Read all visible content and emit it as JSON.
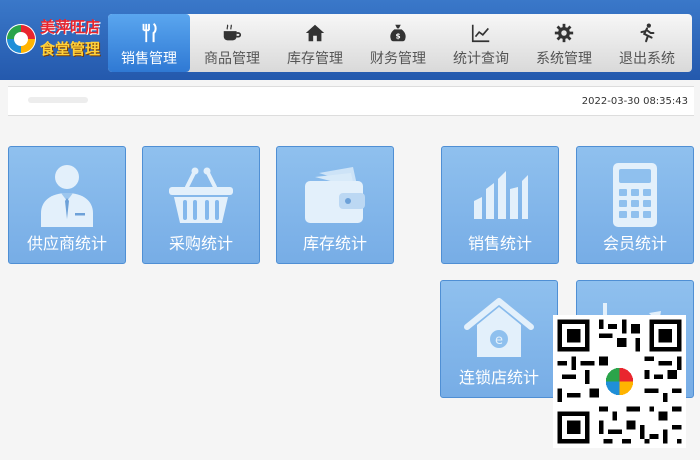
{
  "brand": {
    "line1": "美萍旺店",
    "line2": "食堂管理"
  },
  "nav": {
    "items": [
      {
        "label": "销售管理",
        "icon": "fork-knife-icon",
        "active": true
      },
      {
        "label": "商品管理",
        "icon": "coffee-cup-icon"
      },
      {
        "label": "库存管理",
        "icon": "house-icon"
      },
      {
        "label": "财务管理",
        "icon": "money-bag-icon"
      },
      {
        "label": "统计查询",
        "icon": "line-chart-icon"
      },
      {
        "label": "系统管理",
        "icon": "gear-icon"
      },
      {
        "label": "退出系统",
        "icon": "running-person-icon"
      }
    ]
  },
  "status": {
    "datetime": "2022-03-30 08:35:43"
  },
  "tiles": [
    {
      "label": "供应商统计",
      "icon": "business-person-icon"
    },
    {
      "label": "采购统计",
      "icon": "basket-icon"
    },
    {
      "label": "库存统计",
      "icon": "wallet-icon"
    },
    {
      "label": "销售统计",
      "icon": "bar-chart-icon"
    },
    {
      "label": "会员统计",
      "icon": "calculator-icon"
    },
    {
      "label": "连锁店统计",
      "icon": "chain-store-house-icon"
    },
    {
      "label": "",
      "icon": "trend-chart-icon"
    }
  ],
  "colors": {
    "header": "#2e6bc0",
    "tile": "#84b8ec",
    "tile_border": "#4f8fd4",
    "nav_active": "#3f8ee2",
    "logo_red": "#e9262e",
    "logo_yellow": "#ffd13a"
  },
  "overlay": {
    "icon": "qr-code-icon"
  }
}
